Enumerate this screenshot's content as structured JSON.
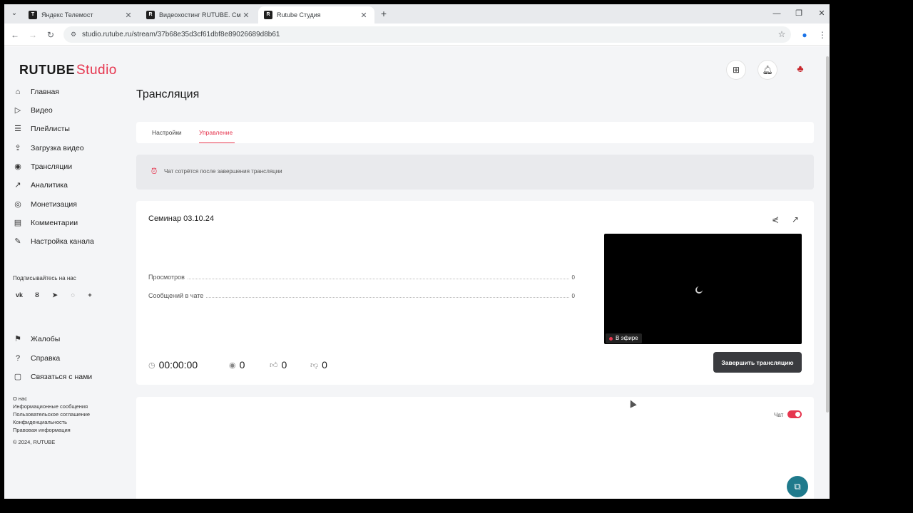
{
  "browser": {
    "tabs": [
      {
        "favicon": "Т",
        "title": "Яндекс Телемост"
      },
      {
        "favicon": "R",
        "title": "Видеохостинг RUTUBE. Смотрите"
      },
      {
        "favicon": "R",
        "title": "Rutube Студия"
      }
    ],
    "url": "studio.rutube.ru/stream/37b68e35d3cf61dbf8e89026689d8b61"
  },
  "logo": {
    "brand": "RUTUBE",
    "product": "Studio"
  },
  "sidebar": {
    "items": [
      {
        "label": "Главная"
      },
      {
        "label": "Видео"
      },
      {
        "label": "Плейлисты"
      },
      {
        "label": "Загрузка видео"
      },
      {
        "label": "Трансляции"
      },
      {
        "label": "Аналитика"
      },
      {
        "label": "Монетизация"
      },
      {
        "label": "Комментарии"
      },
      {
        "label": "Настройка канала"
      }
    ],
    "social_heading": "Подписывайтесь на нас",
    "bottom_items": [
      {
        "label": "Жалобы"
      },
      {
        "label": "Справка"
      },
      {
        "label": "Связаться с нами"
      }
    ],
    "footer_links": [
      "О нас",
      "Информационные сообщения",
      "Пользовательское соглашение",
      "Конфиденциальность",
      "Правовая информация"
    ],
    "copyright": "© 2024, RUTUBE"
  },
  "page": {
    "title": "Трансляция",
    "tabs": [
      {
        "label": "Настройки"
      },
      {
        "label": "Управление"
      }
    ],
    "active_tab": "Управление",
    "alert_text": "Чат сотрётся после завершения трансляции"
  },
  "stream": {
    "title": "Семинар 03.10.24",
    "stats": [
      {
        "label": "Просмотров",
        "value": "0"
      },
      {
        "label": "Сообщений в чате",
        "value": "0"
      }
    ],
    "live_badge": "В эфире",
    "timer": "00:00:00",
    "viewers": "0",
    "likes": "0",
    "dislikes": "0",
    "end_button": "Завершить трансляцию"
  },
  "chat": {
    "label": "Чат",
    "enabled": true
  },
  "colors": {
    "accent": "#e6364f",
    "dark_button": "#3a3b3f",
    "fab": "#1f7a8c"
  }
}
